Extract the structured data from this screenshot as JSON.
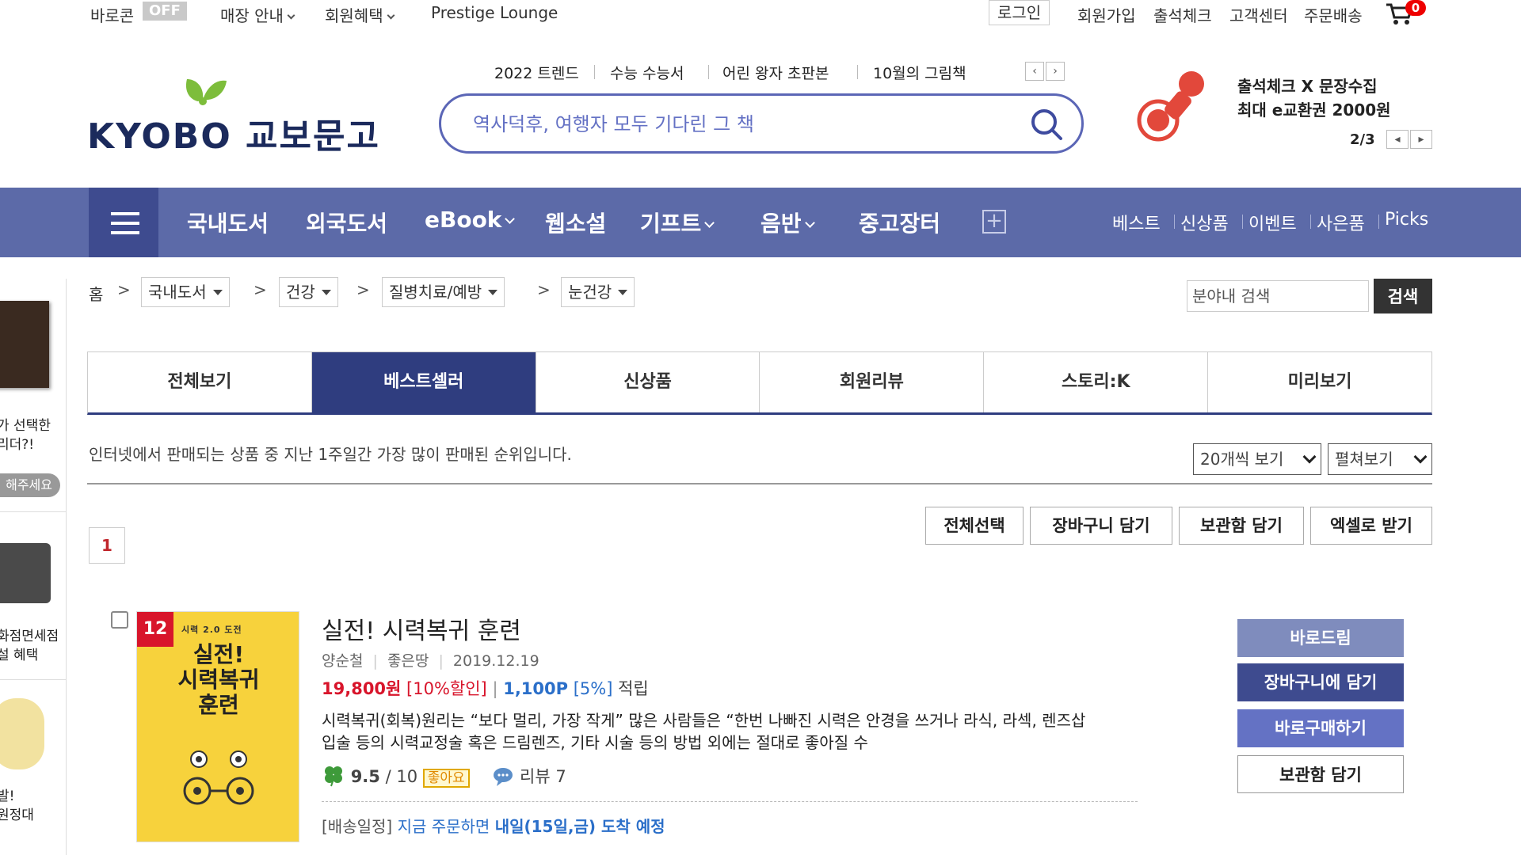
{
  "util_bar": {
    "barocon": "바로콘",
    "off": "OFF",
    "store_guide": "매장 안내",
    "member_benefit": "회원혜택",
    "prestige": "Prestige Lounge",
    "login": "로그인",
    "join": "회원가입",
    "checkin": "출석체크",
    "support": "고객센터",
    "order": "주문배송",
    "cart_count": "0"
  },
  "logo": {
    "text": "KYOBO 교보문고"
  },
  "trends": [
    "2022 트렌드",
    "수능 수능서",
    "어린 왕자 초판본",
    "10월의 그림책"
  ],
  "search": {
    "placeholder": "역사덕후, 여행자 모두 기다린 그 책"
  },
  "promo": {
    "line1": "출석체크 X 문장수집",
    "line2": "최대 e교환권 2000원",
    "counter": "2/3"
  },
  "nav": {
    "items": [
      "국내도서",
      "외국도서",
      "eBook",
      "웹소설",
      "기프트",
      "음반",
      "중고장터"
    ],
    "right": [
      "베스트",
      "신상품",
      "이벤트",
      "사은품",
      "Picks"
    ]
  },
  "side": {
    "text1a": "가 선택한",
    "text1b": "리더?!",
    "pill": "해주세요",
    "text2a": "화점면세점",
    "text2b": "설 혜택",
    "text3a": "발!",
    "text3b": "원정대"
  },
  "breadcrumb": {
    "home": "홈",
    "levels": [
      "국내도서",
      "건강",
      "질병치료/예방",
      "눈건강"
    ]
  },
  "inner_search": {
    "placeholder": "분야내 검색",
    "button": "검색"
  },
  "tabs": [
    "전체보기",
    "베스트셀러",
    "신상품",
    "회원리뷰",
    "스토리:K",
    "미리보기"
  ],
  "list_info": {
    "description": "인터넷에서 판매되는 상품 중 지난 1주일간 가장 많이 판매된 순위입니다.",
    "per_page": "20개씩 보기",
    "view_mode": "펼쳐보기",
    "page": "1"
  },
  "actions": [
    "전체선택",
    "장바구니 담기",
    "보관함 담기",
    "엑셀로 받기"
  ],
  "product": {
    "rank": "12",
    "cover_series": "시력 2.0 도전",
    "cover_title_1": "실전!",
    "cover_title_2": "시력복귀",
    "cover_title_3": "훈련",
    "title": "실전! 시력복귀 훈련",
    "author": "양순철",
    "publisher": "좋은땅",
    "date": "2019.12.19",
    "price": "19,800원",
    "discount": "[10%할인]",
    "points": "1,100P",
    "points_rate": "[5%]",
    "points_label": "적립",
    "desc_line1": "시력복귀(회복)원리는 “보다 멀리, 가장 작게” 많은 사람들은 “한번 나빠진 시력은 안경을 쓰거나 라식, 라섹, 렌즈삽",
    "desc_line2": "입술 등의 시력교정술 혹은 드림렌즈, 기타 시술 등의 방법 외에는 절대로 좋아질 수",
    "rating": "9.5",
    "rating_max": "/ 10",
    "rating_badge": "좋아요",
    "review_label": "리뷰 7",
    "ship_prefix": "[배송일정]",
    "ship_mid": "지금 주문하면",
    "ship_date": "내일(15일,금) 도착 예정"
  },
  "product_buttons": [
    "바로드림",
    "장바구니에 담기",
    "바로구매하기",
    "보관함 담기"
  ]
}
